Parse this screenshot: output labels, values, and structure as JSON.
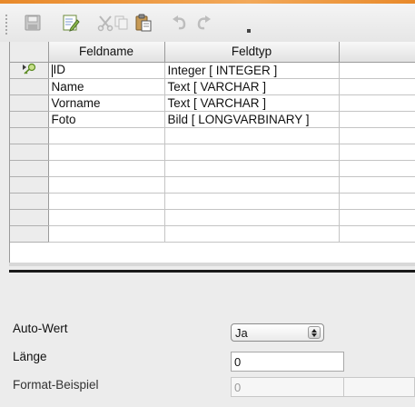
{
  "toolbar": {
    "buttons": [
      {
        "icon": "save-icon",
        "enabled": false
      },
      {
        "icon": "edit-icon",
        "enabled": true
      },
      {
        "icon": "cut-icon",
        "enabled": false
      },
      {
        "icon": "copy-icon",
        "enabled": false
      },
      {
        "icon": "paste-icon",
        "enabled": true
      },
      {
        "icon": "undo-icon",
        "enabled": false
      },
      {
        "icon": "redo-icon",
        "enabled": false
      }
    ]
  },
  "grid": {
    "columns": [
      "Feldname",
      "Feldtyp"
    ],
    "rows": [
      {
        "name": "ID",
        "type": "Integer [ INTEGER ]",
        "primary_key": true,
        "active": true
      },
      {
        "name": "Name",
        "type": "Text [ VARCHAR ]"
      },
      {
        "name": "Vorname",
        "type": "Text [ VARCHAR ]"
      },
      {
        "name": "Foto",
        "type": "Bild [ LONGVARBINARY ]"
      },
      {
        "name": "",
        "type": ""
      },
      {
        "name": "",
        "type": ""
      },
      {
        "name": "",
        "type": ""
      },
      {
        "name": "",
        "type": ""
      },
      {
        "name": "",
        "type": ""
      },
      {
        "name": "",
        "type": ""
      },
      {
        "name": "",
        "type": ""
      }
    ]
  },
  "properties": {
    "auto_wert": {
      "label": "Auto-Wert",
      "value": "Ja"
    },
    "laenge": {
      "label": "Länge",
      "value": "0"
    },
    "format_beispiel": {
      "label": "Format-Beispiel",
      "value": "0"
    }
  },
  "colors": {
    "title_accent": "#e8892a",
    "key_icon": "#7fb83a"
  }
}
